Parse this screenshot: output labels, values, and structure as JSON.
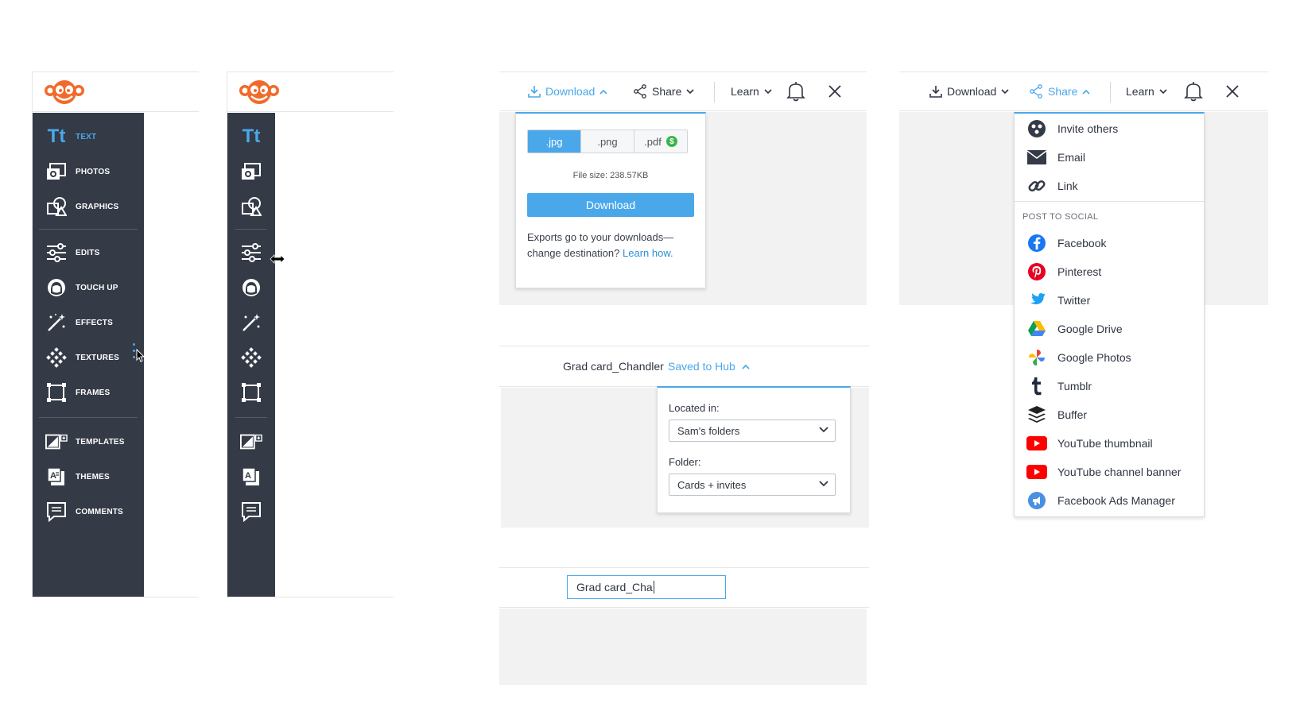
{
  "sidebar": {
    "items": [
      {
        "label": "TEXT",
        "icon": "text-icon"
      },
      {
        "label": "PHOTOS",
        "icon": "photos-icon"
      },
      {
        "label": "GRAPHICS",
        "icon": "graphics-icon"
      },
      {
        "label": "EDITS",
        "icon": "edits-icon"
      },
      {
        "label": "TOUCH UP",
        "icon": "touch-up-icon"
      },
      {
        "label": "EFFECTS",
        "icon": "effects-icon"
      },
      {
        "label": "TEXTURES",
        "icon": "textures-icon"
      },
      {
        "label": "FRAMES",
        "icon": "frames-icon"
      },
      {
        "label": "TEMPLATES",
        "icon": "templates-icon"
      },
      {
        "label": "THEMES",
        "icon": "themes-icon"
      },
      {
        "label": "COMMENTS",
        "icon": "comments-icon"
      }
    ]
  },
  "toolbar": {
    "download_label": "Download",
    "share_label": "Share",
    "learn_label": "Learn"
  },
  "download_panel": {
    "formats": [
      ".jpg",
      ".png",
      ".pdf"
    ],
    "selected_format": ".jpg",
    "pdf_badge": "$",
    "file_size": "File size: 238.57KB",
    "download_button": "Download",
    "exports_note": "Exports go to your downloads—change destination?",
    "learn_how": "Learn how."
  },
  "save_bar": {
    "doc_name": "Grad card_Chandler",
    "saved_status": "Saved to Hub",
    "located_label": "Located in:",
    "located_value": "Sam's folders",
    "folder_label": "Folder:",
    "folder_value": "Cards + invites"
  },
  "rename": {
    "value": "Grad card_Cha"
  },
  "share_panel": {
    "top_items": [
      {
        "label": "Invite others",
        "icon": "invite-others-icon"
      },
      {
        "label": "Email",
        "icon": "email-icon"
      },
      {
        "label": "Link",
        "icon": "link-icon"
      }
    ],
    "social_heading": "POST TO SOCIAL",
    "social_items": [
      {
        "label": "Facebook",
        "icon": "facebook-icon"
      },
      {
        "label": "Pinterest",
        "icon": "pinterest-icon"
      },
      {
        "label": "Twitter",
        "icon": "twitter-icon"
      },
      {
        "label": "Google Drive",
        "icon": "google-drive-icon"
      },
      {
        "label": "Google Photos",
        "icon": "google-photos-icon"
      },
      {
        "label": "Tumblr",
        "icon": "tumblr-icon"
      },
      {
        "label": "Buffer",
        "icon": "buffer-icon"
      },
      {
        "label": "YouTube thumbnail",
        "icon": "youtube-icon"
      },
      {
        "label": "YouTube channel banner",
        "icon": "youtube-icon"
      },
      {
        "label": "Facebook Ads Manager",
        "icon": "facebook-ads-manager-icon"
      }
    ]
  },
  "colors": {
    "accent": "#4aa8ea",
    "sidebar_bg": "#343a46",
    "logo": "#f26a2b"
  }
}
